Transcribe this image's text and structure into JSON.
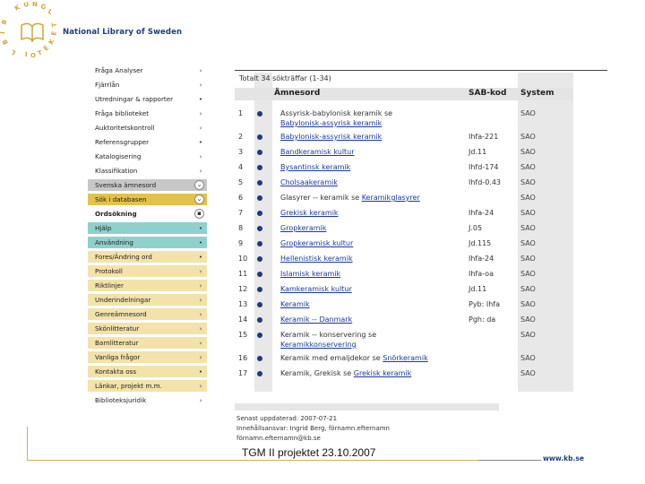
{
  "org_name": "National Library of Sweden",
  "logo_text": "KUNGL BIBLIOTEKET",
  "sidebar": {
    "items": [
      {
        "label": "Fråga Analyser",
        "marker": "›",
        "style": "white"
      },
      {
        "label": "Fjärrlån",
        "marker": "›",
        "style": "white"
      },
      {
        "label": "Utredningar & rapporter",
        "marker": "•",
        "style": "white"
      },
      {
        "label": "Fråga biblioteket",
        "marker": "›",
        "style": "white"
      },
      {
        "label": "Auktoritetskontroll",
        "marker": "›",
        "style": "white"
      },
      {
        "label": "Referensgrupper",
        "marker": "•",
        "style": "white"
      },
      {
        "label": "Katalogisering",
        "marker": "›",
        "style": "white"
      },
      {
        "label": "Klassifikation",
        "marker": "›",
        "style": "white"
      },
      {
        "label": "Svenska ämnesord",
        "marker": "⌄",
        "style": "grey"
      },
      {
        "label": "Sök i databasen",
        "marker": "⌄",
        "style": "gold"
      },
      {
        "label": "Ordsökning",
        "marker": "▪",
        "style": "sel"
      },
      {
        "label": "Hjälp",
        "marker": "•",
        "style": "teal"
      },
      {
        "label": "Användning",
        "marker": "•",
        "style": "teal"
      },
      {
        "label": "Fores/Ändring ord",
        "marker": "•",
        "style": "tan"
      },
      {
        "label": "Protokoll",
        "marker": "›",
        "style": "tan"
      },
      {
        "label": "Riktlinjer",
        "marker": "›",
        "style": "tan"
      },
      {
        "label": "Underindelningar",
        "marker": "›",
        "style": "tan"
      },
      {
        "label": "Genreämnesord",
        "marker": "›",
        "style": "tan"
      },
      {
        "label": "Skönlitteratur",
        "marker": "›",
        "style": "tan"
      },
      {
        "label": "Barnlitteratur",
        "marker": "›",
        "style": "tan"
      },
      {
        "label": "Vanliga frågor",
        "marker": "›",
        "style": "tan"
      },
      {
        "label": "Kontakta oss",
        "marker": "•",
        "style": "tan"
      },
      {
        "label": "Länkar, projekt m.m.",
        "marker": "›",
        "style": "tan"
      },
      {
        "label": "Biblioteksjuridik",
        "marker": "›",
        "style": "white"
      }
    ]
  },
  "results": {
    "total_text": "Totalt 34 sökträffar (1-34)",
    "headers": {
      "term": "Ämnesord",
      "sab": "SAB-kod",
      "system": "System"
    },
    "rows": [
      {
        "num": "1",
        "term": "Assyrisk-babylonisk keramik se",
        "term2": "Babylonisk-assyrisk keramik",
        "sab": "",
        "system": "SAO"
      },
      {
        "num": "2",
        "term": "Babylonisk-assyrisk keramik",
        "sab": "Ihfa-221",
        "system": "SAO"
      },
      {
        "num": "3",
        "term": "Bandkeramisk kultur",
        "sab": "Jd.11",
        "system": "SAO"
      },
      {
        "num": "4",
        "term": "Bysantinsk keramik",
        "sab": "Ihfd-174",
        "system": "SAO"
      },
      {
        "num": "5",
        "term": "Cholsaakeramik",
        "sab": "Ihfd-0.43",
        "system": "SAO"
      },
      {
        "num": "6",
        "term": "Glasyrer -- keramik se",
        "term_link": "Keramikglasyrer",
        "sab": "",
        "system": "SAO"
      },
      {
        "num": "7",
        "term": "Grekisk keramik",
        "sab": "Ihfa-24",
        "system": "SAO"
      },
      {
        "num": "8",
        "term": "Gropkeramik",
        "sab": "J.05",
        "system": "SAO"
      },
      {
        "num": "9",
        "term": "Gropkeramisk kultur",
        "sab": "Jd.115",
        "system": "SAO"
      },
      {
        "num": "10",
        "term": "Hellenistisk keramik",
        "sab": "Ihfa-24",
        "system": "SAO"
      },
      {
        "num": "11",
        "term": "Islamisk keramik",
        "sab": "Ihfa-oa",
        "system": "SAO"
      },
      {
        "num": "12",
        "term": "Kamkeramisk kultur",
        "sab": "Jd.11",
        "system": "SAO"
      },
      {
        "num": "13",
        "term": "Keramik",
        "sab": "Pyb: Ihfa",
        "system": "SAO"
      },
      {
        "num": "14",
        "term": "Keramik -- Danmark",
        "sab": "Pgh: da",
        "system": "SAO"
      },
      {
        "num": "15",
        "term": "Keramik -- konservering se",
        "term2": "Keramikkonservering",
        "sab": "",
        "system": "SAO"
      },
      {
        "num": "16",
        "term": "Keramik med emaljdekor se",
        "term_link": "Snörkeramik",
        "sab": "",
        "system": "SAO"
      },
      {
        "num": "17",
        "term": "Keramik, Grekisk se",
        "term_link": "Grekisk keramik",
        "sab": "",
        "system": "SAO"
      }
    ]
  },
  "footer": {
    "updated": "Senast uppdaterad: 2007-07-21",
    "responsible": "Innehållsansvar: Ingrid Berg, förnamn.efternamn",
    "email": "förnamn.efternamn@kb.se"
  },
  "caption": "TGM II projektet 23.10.2007",
  "site": "www.kb.se",
  "colors": {
    "brand": "#1e3d7a",
    "gold": "#e3c24a",
    "teal": "#8fd0cd",
    "tan": "#f3e2a9",
    "link": "#1a3a9a"
  }
}
